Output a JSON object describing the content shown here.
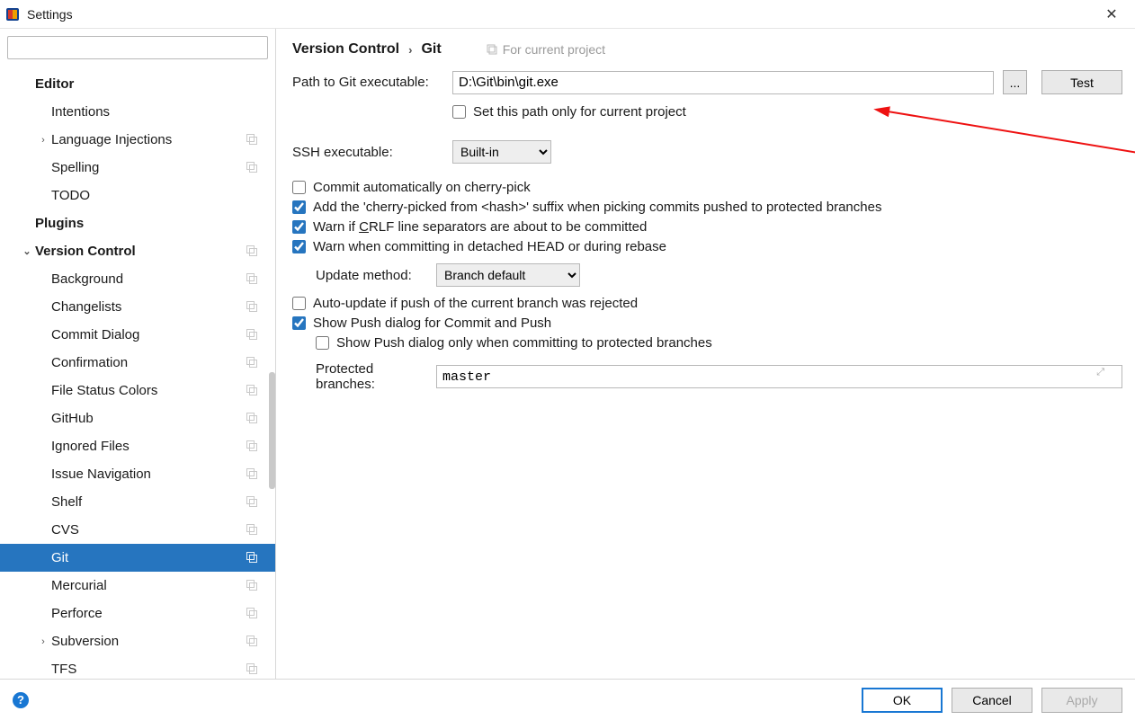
{
  "window": {
    "title": "Settings",
    "close_glyph": "✕"
  },
  "search": {
    "placeholder": ""
  },
  "sidebar": {
    "items": [
      {
        "label": "Editor",
        "bold": true,
        "indent": 37,
        "chev": "",
        "proj": false
      },
      {
        "label": "Intentions",
        "bold": false,
        "indent": 55,
        "chev": "",
        "proj": false
      },
      {
        "label": "Language Injections",
        "bold": false,
        "indent": 55,
        "chev": "›",
        "proj": true
      },
      {
        "label": "Spelling",
        "bold": false,
        "indent": 55,
        "chev": "",
        "proj": true
      },
      {
        "label": "TODO",
        "bold": false,
        "indent": 55,
        "chev": "",
        "proj": false
      },
      {
        "label": "Plugins",
        "bold": true,
        "indent": 37,
        "chev": "",
        "proj": false
      },
      {
        "label": "Version Control",
        "bold": true,
        "indent": 37,
        "chev": "⌄",
        "proj": true
      },
      {
        "label": "Background",
        "bold": false,
        "indent": 55,
        "chev": "",
        "proj": true
      },
      {
        "label": "Changelists",
        "bold": false,
        "indent": 55,
        "chev": "",
        "proj": true
      },
      {
        "label": "Commit Dialog",
        "bold": false,
        "indent": 55,
        "chev": "",
        "proj": true
      },
      {
        "label": "Confirmation",
        "bold": false,
        "indent": 55,
        "chev": "",
        "proj": true
      },
      {
        "label": "File Status Colors",
        "bold": false,
        "indent": 55,
        "chev": "",
        "proj": true
      },
      {
        "label": "GitHub",
        "bold": false,
        "indent": 55,
        "chev": "",
        "proj": true
      },
      {
        "label": "Ignored Files",
        "bold": false,
        "indent": 55,
        "chev": "",
        "proj": true
      },
      {
        "label": "Issue Navigation",
        "bold": false,
        "indent": 55,
        "chev": "",
        "proj": true
      },
      {
        "label": "Shelf",
        "bold": false,
        "indent": 55,
        "chev": "",
        "proj": true
      },
      {
        "label": "CVS",
        "bold": false,
        "indent": 55,
        "chev": "",
        "proj": true
      },
      {
        "label": "Git",
        "bold": false,
        "indent": 55,
        "chev": "",
        "proj": true,
        "selected": true
      },
      {
        "label": "Mercurial",
        "bold": false,
        "indent": 55,
        "chev": "",
        "proj": true
      },
      {
        "label": "Perforce",
        "bold": false,
        "indent": 55,
        "chev": "",
        "proj": true
      },
      {
        "label": "Subversion",
        "bold": false,
        "indent": 55,
        "chev": "›",
        "proj": true
      },
      {
        "label": "TFS",
        "bold": false,
        "indent": 55,
        "chev": "",
        "proj": true
      }
    ]
  },
  "breadcrumb": {
    "a": "Version Control",
    "sep": "›",
    "b": "Git",
    "hint": "For current project"
  },
  "form": {
    "path_label": "Path to Git executable:",
    "path_value": "D:\\Git\\bin\\git.exe",
    "browse": "...",
    "test": "Test",
    "only_project": "Set this path only for current project",
    "ssh_label": "SSH executable:",
    "ssh_value": "Built-in",
    "commit_auto": "Commit automatically on cherry-pick",
    "cherry_suffix": "Add the 'cherry-picked from <hash>' suffix when picking commits pushed to protected branches",
    "crlf_pre": "Warn if ",
    "crlf_u": "C",
    "crlf_post": "RLF line separators are about to be committed",
    "detached": "Warn when committing in detached HEAD or during rebase",
    "update_label": "Update method:",
    "update_value": "Branch default",
    "auto_update": "Auto-update if push of the current branch was rejected",
    "show_push": "Show Push dialog for Commit and Push",
    "show_push_protected": "Show Push dialog only when committing to protected branches",
    "protected_label": "Protected branches:",
    "protected_value": "master"
  },
  "footer": {
    "help": "?",
    "ok": "OK",
    "cancel": "Cancel",
    "apply": "Apply"
  }
}
